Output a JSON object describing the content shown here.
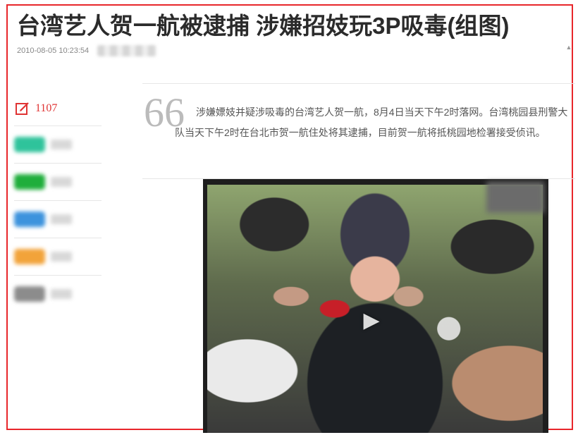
{
  "article": {
    "headline": "台湾艺人贺一航被逮捕 涉嫌招妓玩3P吸毒(组图)",
    "timestamp": "2010-08-05 10:23:54",
    "comment_count": "1107",
    "summary": "涉嫌嫖妓并疑涉吸毒的台湾艺人贺一航，8月4日当天下午2时落网。台湾桃园县刑警大队当天下午2时在台北市贺一航住处将其逮捕，目前贺一航将抵桃园地检署接受侦讯。",
    "quote_mark": "66"
  },
  "share": {
    "items": [
      {
        "icon": "share-icon-1",
        "color": "#2fc39b"
      },
      {
        "icon": "share-icon-2",
        "color": "#1fae3b"
      },
      {
        "icon": "share-icon-3",
        "color": "#3d93dd"
      },
      {
        "icon": "share-icon-4",
        "color": "#f2a33a"
      },
      {
        "icon": "share-icon-5",
        "color": "#8c8c8c"
      }
    ]
  },
  "video": {
    "play_icon": "▶"
  },
  "colors": {
    "accent": "#e03434",
    "frame": "#e8262b"
  }
}
